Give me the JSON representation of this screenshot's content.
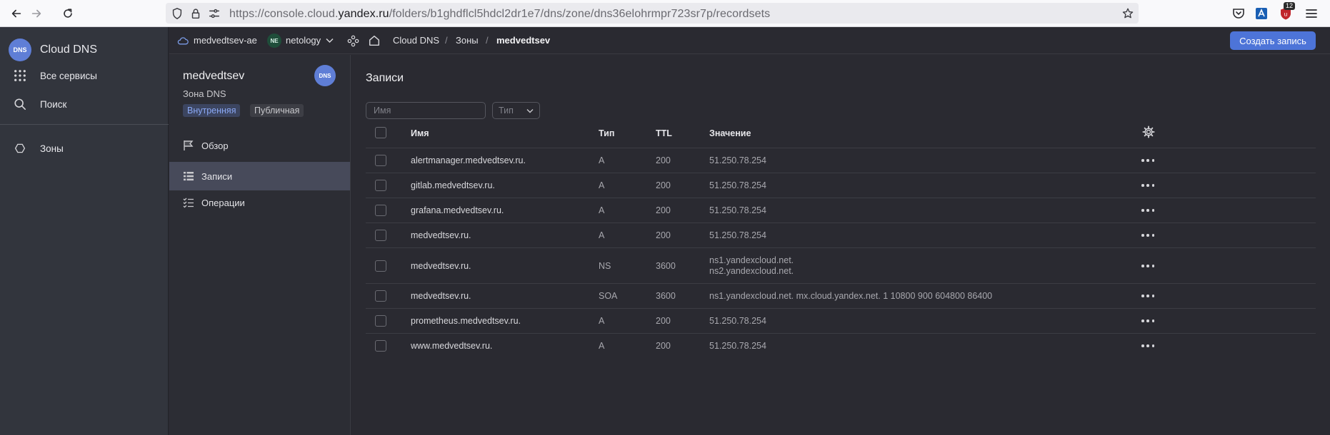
{
  "browser": {
    "url_prefix": "https://console.cloud.",
    "url_domain": "yandex.ru",
    "url_path": "/folders/b1ghdflcl5hdcl2dr1e7/dns/zone/dns36elohrmpr723sr7p/recordsets",
    "extension_badge": "12"
  },
  "leftnav": {
    "app_title": "Cloud DNS",
    "logo_text": "DNS",
    "all_services": "Все сервисы",
    "search": "Поиск",
    "zones": "Зоны"
  },
  "topbar": {
    "cloud": "medvedtsev-ae",
    "folder_badge": "NE",
    "folder": "netology",
    "crumb_service": "Cloud DNS",
    "crumb_zones": "Зоны",
    "crumb_current": "medvedtsev",
    "separator": "/",
    "create_button": "Создать запись"
  },
  "subnav": {
    "zone_name": "medvedtsev",
    "zone_type_label": "Зона DNS",
    "avatar_text": "DNS",
    "tag_internal": "Внутренняя",
    "tag_public": "Публичная",
    "items": [
      {
        "label": "Обзор"
      },
      {
        "label": "Записи"
      },
      {
        "label": "Операции"
      }
    ]
  },
  "main": {
    "title": "Записи",
    "filter_name_placeholder": "Имя",
    "filter_type_placeholder": "Тип",
    "columns": {
      "name": "Имя",
      "type": "Тип",
      "ttl": "TTL",
      "value": "Значение"
    },
    "records": [
      {
        "name": "alertmanager.medvedtsev.ru.",
        "type": "A",
        "ttl": "200",
        "value": "51.250.78.254",
        "value2": ""
      },
      {
        "name": "gitlab.medvedtsev.ru.",
        "type": "A",
        "ttl": "200",
        "value": "51.250.78.254",
        "value2": ""
      },
      {
        "name": "grafana.medvedtsev.ru.",
        "type": "A",
        "ttl": "200",
        "value": "51.250.78.254",
        "value2": ""
      },
      {
        "name": "medvedtsev.ru.",
        "type": "A",
        "ttl": "200",
        "value": "51.250.78.254",
        "value2": ""
      },
      {
        "name": "medvedtsev.ru.",
        "type": "NS",
        "ttl": "3600",
        "value": "ns1.yandexcloud.net.",
        "value2": "ns2.yandexcloud.net."
      },
      {
        "name": "medvedtsev.ru.",
        "type": "SOA",
        "ttl": "3600",
        "value": "ns1.yandexcloud.net. mx.cloud.yandex.net. 1 10800 900 604800 86400",
        "value2": ""
      },
      {
        "name": "prometheus.medvedtsev.ru.",
        "type": "A",
        "ttl": "200",
        "value": "51.250.78.254",
        "value2": ""
      },
      {
        "name": "www.medvedtsev.ru.",
        "type": "A",
        "ttl": "200",
        "value": "51.250.78.254",
        "value2": ""
      }
    ]
  }
}
